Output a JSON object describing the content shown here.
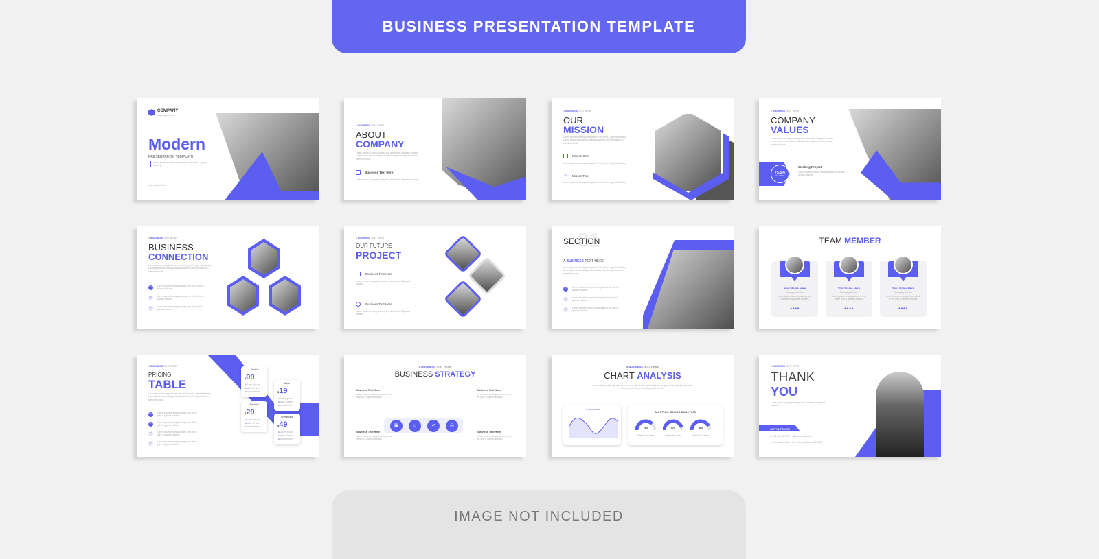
{
  "header": {
    "title": "BUSINESS PRESENTATION TEMPLATE"
  },
  "footer": {
    "note": "IMAGE NOT INCLUDED"
  },
  "colors": {
    "accent": "#5b5ef0",
    "background": "#f1f1f1"
  },
  "common": {
    "kicker_a": "A ",
    "kicker_b": "BUSINESS",
    "kicker_c": " TEXT HERE",
    "lorem": "Lorem ipsum is simply dummy text of the print & typeset industry. Lorem ipsum has industry standard dummy when printer took a specimen book.",
    "lorem_short": "Lorem ipsum is simply dummy text of the print & typeset industry.",
    "business_text": "Business Text Here"
  },
  "s1": {
    "logo": "COMPANY",
    "slogan": "slogan goes here",
    "title": "Modern",
    "subtitle": "PRESENTATION TEMPLATE",
    "website": "Your website here"
  },
  "s2": {
    "title_a": "ABOUT",
    "title_b": "COMPANY"
  },
  "s3": {
    "title_a": "OUR",
    "title_b": "MISSION",
    "item1": "Misson One",
    "item2": "Misson Two"
  },
  "s4": {
    "title_a": "COMPANY",
    "title_b": "VALUES",
    "stat": "75.5%",
    "stat_label": "Done Work",
    "project": "Working Project"
  },
  "s5": {
    "title_a": "BUSINESS",
    "title_b": "CONNECTION"
  },
  "s6": {
    "title_a": "OUR FUTURE",
    "title_b": "PROJECT"
  },
  "s7": {
    "title": "SECTION",
    "number": "01"
  },
  "s8": {
    "title_a": "TEAM ",
    "title_b": "MEMBER",
    "members": [
      {
        "name": "Your Name Here",
        "role": "Managing Director"
      },
      {
        "name": "Your Name Here",
        "role": "Managing Director"
      },
      {
        "name": "Your Name Here",
        "role": "Managing Director"
      }
    ]
  },
  "s9": {
    "title_a": "PRICING",
    "title_b": "TABLE",
    "plans": [
      {
        "name": "Started",
        "price": "09"
      },
      {
        "name": "Basic",
        "price": "19"
      },
      {
        "name": "Standard",
        "price": "29"
      },
      {
        "name": "Professional",
        "price": "49"
      }
    ],
    "currency": "$",
    "features": [
      "Lorem ipsum",
      "dolor sit amet",
      "consectetuer"
    ]
  },
  "s10": {
    "title_a": "BUSINESS ",
    "title_b": "STRATEGY"
  },
  "s11": {
    "title_a": "CHART ",
    "title_b": "ANALYSIS",
    "line_title": "TOTAL INCOME",
    "gauge_title": "MONTHLY CHART ANALYSIS",
    "gauges": [
      {
        "value": "75%",
        "label": "Simple Text Here"
      },
      {
        "value": "90%",
        "label": "Simple Text Here"
      },
      {
        "value": "85%",
        "label": "Simple Text Here"
      }
    ]
  },
  "s12": {
    "title_a": "THANK",
    "title_b": "YOU",
    "cta": "GET IN TOUCH",
    "phone": "+01 123 456 789",
    "website": "Your website here",
    "address": "Your Address Goes Here, Country Name, ABC1234"
  }
}
